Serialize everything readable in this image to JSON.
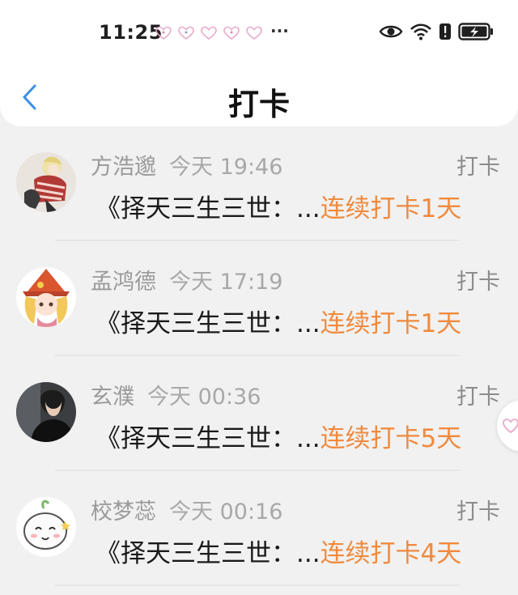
{
  "status_bar": {
    "time": "11:25",
    "more": "···",
    "notification_icons": [
      "heart-icon",
      "heart-icon",
      "heart-icon",
      "heart-icon",
      "heart-icon"
    ],
    "system_icons": [
      "eye-icon",
      "wifi-icon",
      "alert-icon",
      "battery-charging-icon"
    ]
  },
  "header": {
    "title": "打卡",
    "back_icon": "chevron-left-icon"
  },
  "colors": {
    "accent_orange": "#f08a3e",
    "back_blue": "#3f8fe6",
    "muted_gray": "#9a9a9a"
  },
  "records": [
    {
      "name": "方浩邈",
      "time": "今天 19:46",
      "type": "打卡",
      "book": "《择天三生三世：...",
      "streak": "连续打卡1天",
      "avatar_icon": "anime-boy-avatar-icon"
    },
    {
      "name": "孟鸿德",
      "time": "今天 17:19",
      "type": "打卡",
      "book": "《择天三生三世：...",
      "streak": "连续打卡1天",
      "avatar_icon": "witch-girl-avatar-icon"
    },
    {
      "name": "玄濮",
      "time": "今天 00:36",
      "type": "打卡",
      "book": "《择天三生三世：...",
      "streak": "连续打卡5天",
      "avatar_icon": "photo-man-avatar-icon"
    },
    {
      "name": "校梦蕊",
      "time": "今天 00:16",
      "type": "打卡",
      "book": "《择天三生三世：...",
      "streak": "连续打卡4天",
      "avatar_icon": "cute-bun-avatar-icon"
    }
  ]
}
